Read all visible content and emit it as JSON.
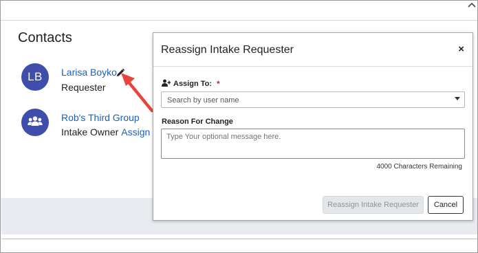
{
  "panel": {
    "title": "Contacts"
  },
  "contacts": [
    {
      "initials": "LB",
      "name": "Larisa Boyko",
      "role": "Requester",
      "avatar_color": "#3e4eaa"
    },
    {
      "name": "Rob's Third Group",
      "role": "Intake Owner",
      "link": "Assign T",
      "avatar_icon": "group-icon",
      "avatar_color": "#3e4eaa"
    }
  ],
  "modal": {
    "title": "Reassign Intake Requester",
    "close": "×",
    "assign_to": {
      "label": "Assign To:",
      "required_mark": "*",
      "placeholder": "Search by user name"
    },
    "reason": {
      "label": "Reason For Change",
      "placeholder": "Type Your optional message here.",
      "chars_remaining": "4000 Characters Remaining"
    },
    "buttons": {
      "submit": "Reassign Intake Requester",
      "cancel": "Cancel"
    }
  },
  "colors": {
    "link": "#1b61b8",
    "accent": "#3e4eaa",
    "required": "#d0253a",
    "annotation_arrow": "#e8433f"
  }
}
